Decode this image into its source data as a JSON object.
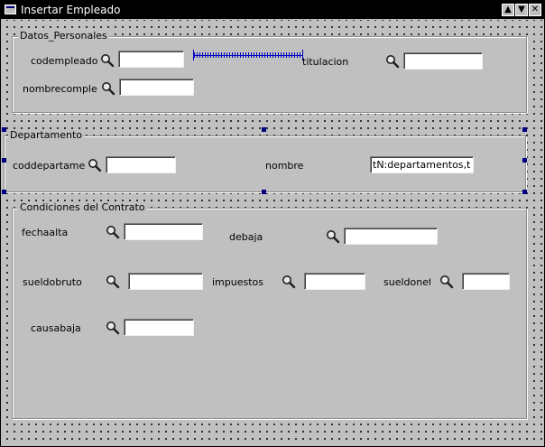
{
  "window": {
    "title": "Insertar Empleado",
    "buttons": {
      "minimize": "▲",
      "maximize": "▼",
      "close": "✕"
    }
  },
  "groups": {
    "datos_personales": {
      "title": "Datos_Personales",
      "fields": {
        "codempleado": {
          "label": "codempleado",
          "value": ""
        },
        "titulacion": {
          "label": "titulacion",
          "value": ""
        },
        "nombrecompleto": {
          "label": "nombrecomple",
          "value": ""
        }
      }
    },
    "departamento": {
      "title": "Departamento",
      "fields": {
        "coddepartamento": {
          "label": "coddepartame",
          "value": ""
        },
        "nombre": {
          "label": "nombre",
          "value": "tN:departamentos,t"
        }
      }
    },
    "condiciones": {
      "title": "Condiciones del Contrato",
      "fields": {
        "fechaalta": {
          "label": "fechaalta",
          "value": ""
        },
        "debaja": {
          "label": "debaja",
          "value": ""
        },
        "sueldobruto": {
          "label": "sueldobruto",
          "value": ""
        },
        "impuestos": {
          "label": "impuestos",
          "value": ""
        },
        "sueldoneto": {
          "label": "sueldonet",
          "value": ""
        },
        "causabaja": {
          "label": "causabaja",
          "value": ""
        }
      }
    }
  },
  "icons": {
    "lookup": "magnifier-icon"
  },
  "colors": {
    "selection_handle": "#000080",
    "spacer": "#0000c0",
    "background": "#c0c0c0"
  }
}
